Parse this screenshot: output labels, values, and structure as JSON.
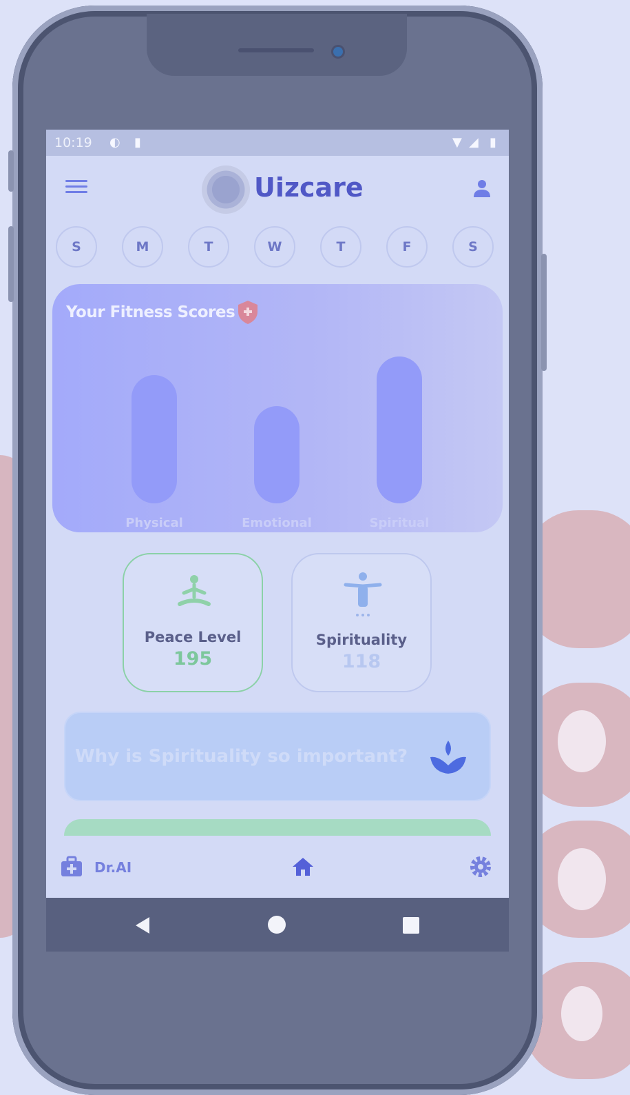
{
  "status_bar": {
    "time": "10:19"
  },
  "app": {
    "title": "Uizcare"
  },
  "week_days": [
    "S",
    "M",
    "T",
    "W",
    "T",
    "F",
    "S"
  ],
  "fitness": {
    "title": "Your Fitness Scores"
  },
  "chart_data": {
    "type": "bar",
    "title": "Your Fitness Scores",
    "categories": [
      "Physical",
      "Emotional",
      "Spiritual"
    ],
    "values": [
      62,
      47,
      71
    ],
    "ylim": [
      0,
      100
    ],
    "grid": false
  },
  "metrics": [
    {
      "label": "Peace Level",
      "value": "195",
      "color": "#7dc79c",
      "icon": "meditation-icon"
    },
    {
      "label": "Spirituality",
      "value": "118",
      "color": "#b7c7f0",
      "icon": "person-arms-open-icon"
    }
  ],
  "info_card": {
    "text": "Why is Spirituality so important?",
    "icon": "lotus-icon"
  },
  "bottom_nav": {
    "drai_label": "Dr.AI"
  },
  "colors": {
    "accent": "#5058c6",
    "bar": "#939bf9",
    "green": "#8bd1a7"
  }
}
